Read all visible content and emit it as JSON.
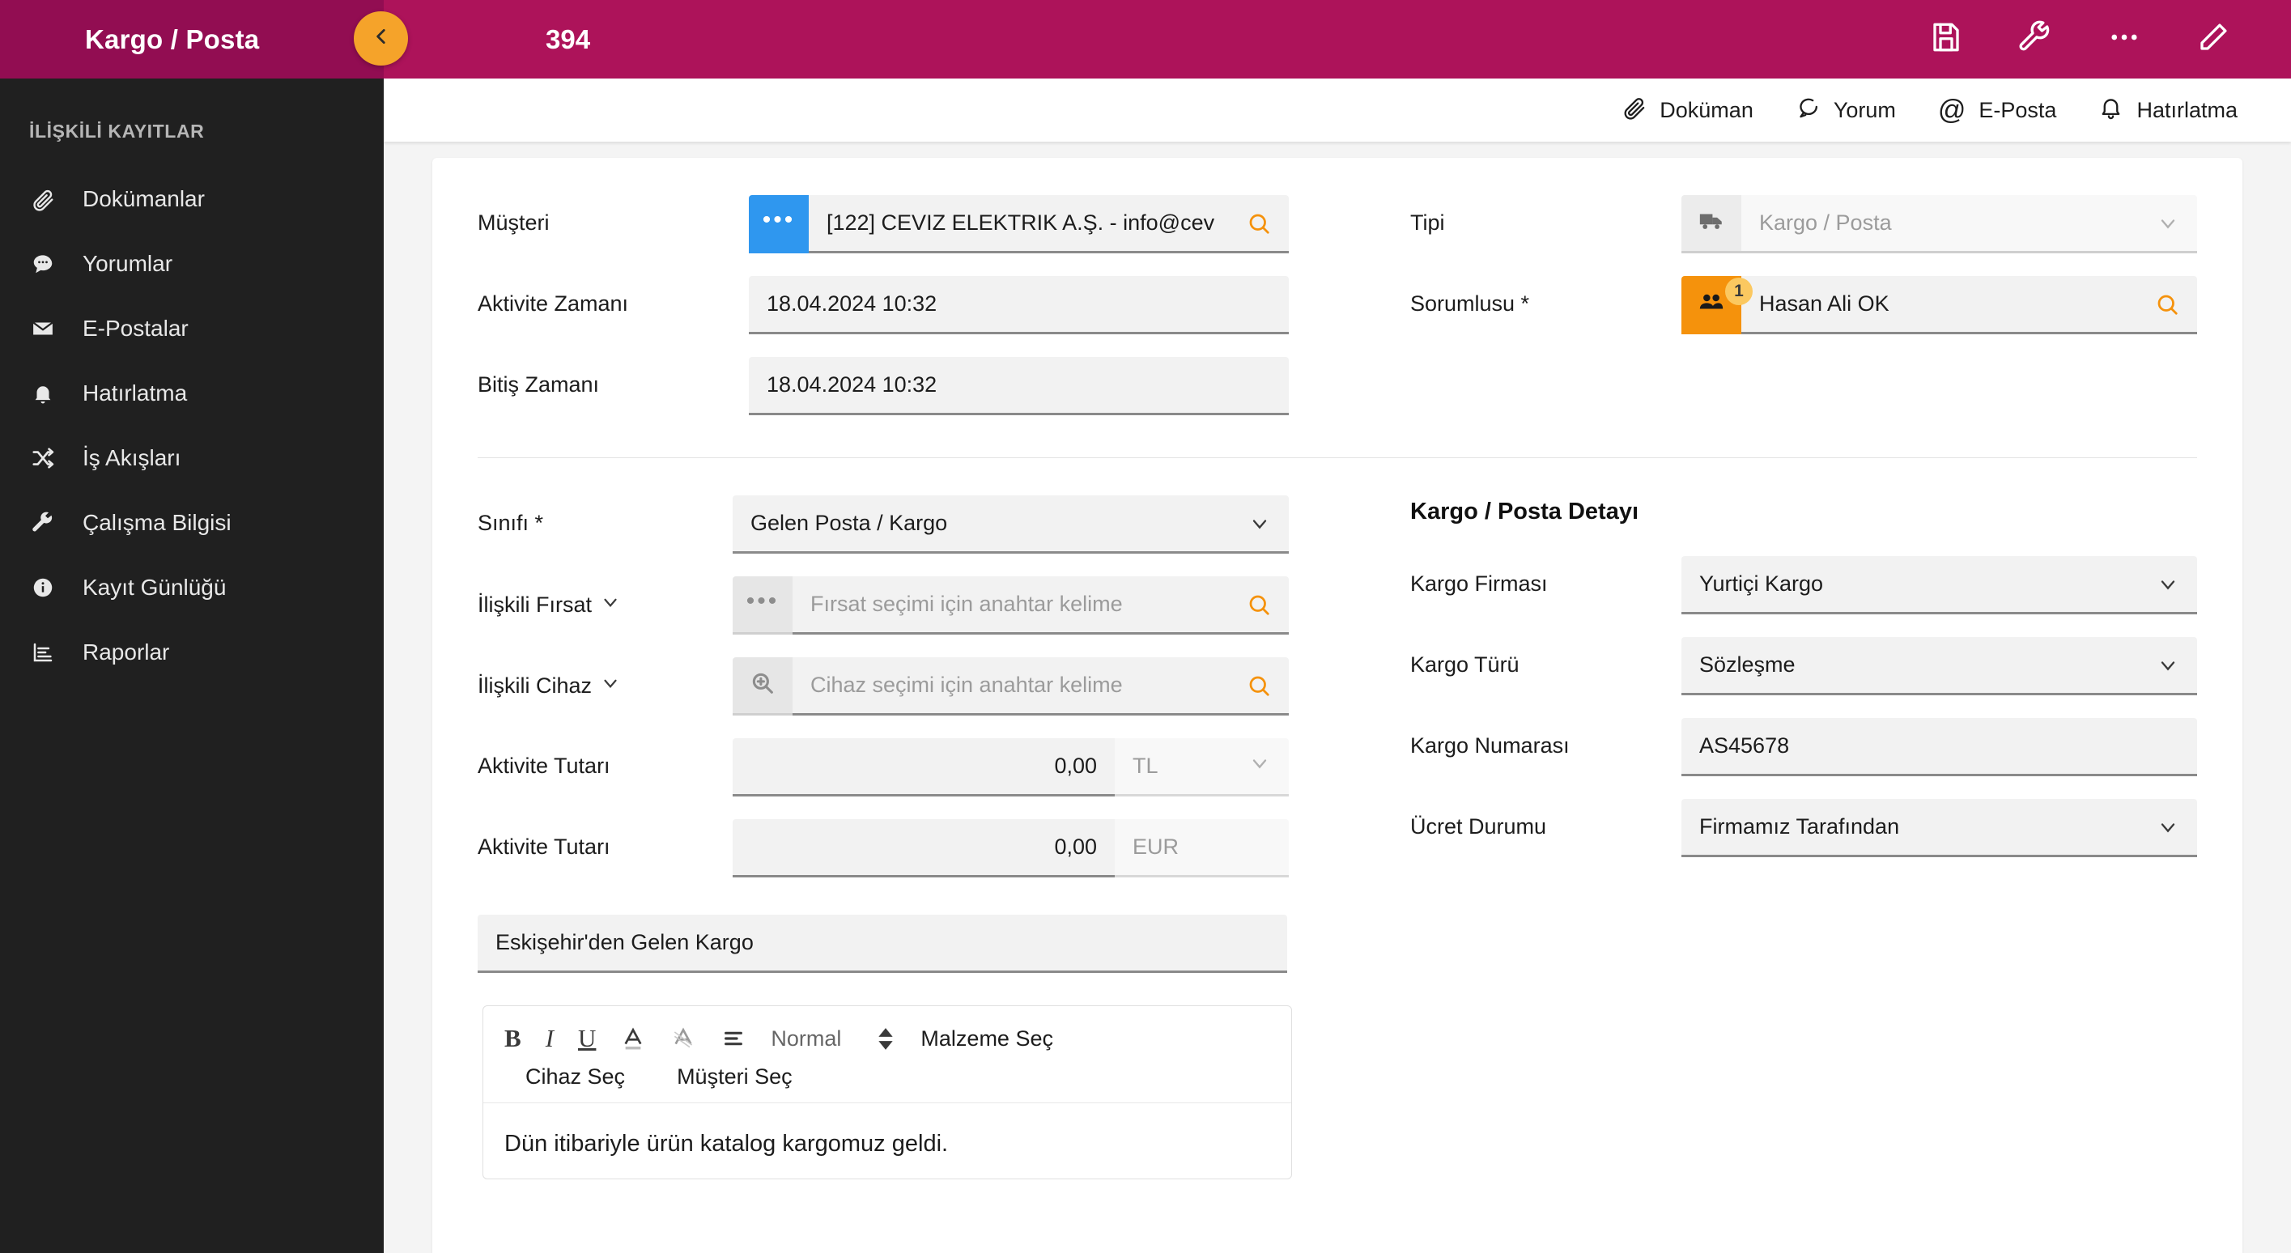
{
  "topbar": {
    "module_title": "Kargo / Posta",
    "record_no": "394",
    "collapse_icon": "chevron-left-icon",
    "actions": [
      {
        "name": "save-button",
        "icon": "floppy-disk-icon"
      },
      {
        "name": "tools-button",
        "icon": "wrench-icon"
      },
      {
        "name": "more-button",
        "icon": "ellipsis-icon"
      },
      {
        "name": "edit-button",
        "icon": "pencil-icon"
      }
    ]
  },
  "tabstrip": {
    "tabs": [
      {
        "label": "Doküman",
        "icon": "paperclip-icon"
      },
      {
        "label": "Yorum",
        "icon": "comment-icon"
      },
      {
        "label": "E-Posta",
        "icon": "at-icon"
      },
      {
        "label": "Hatırlatma",
        "icon": "bell-icon"
      }
    ]
  },
  "sidebar": {
    "heading": "İLİŞKİLİ KAYITLAR",
    "items": [
      {
        "label": "Dokümanlar",
        "icon": "paperclip-icon"
      },
      {
        "label": "Yorumlar",
        "icon": "comment-icon"
      },
      {
        "label": "E-Postalar",
        "icon": "envelope-icon"
      },
      {
        "label": "Hatırlatma",
        "icon": "bell-icon"
      },
      {
        "label": "İş Akışları",
        "icon": "shuffle-icon"
      },
      {
        "label": "Çalışma Bilgisi",
        "icon": "wrench-icon"
      },
      {
        "label": "Kayıt Günlüğü",
        "icon": "info-circle-icon"
      },
      {
        "label": "Raporlar",
        "icon": "report-chart-icon"
      }
    ]
  },
  "form": {
    "musteri": {
      "label": "Müşteri",
      "value": "[122] CEVIZ ELEKTRIK A.Ş.  - info@cev",
      "lookup_icon": "ellipsis-icon",
      "search_icon": "search-icon"
    },
    "aktivite_zamani": {
      "label": "Aktivite Zamanı",
      "value": "18.04.2024 10:32"
    },
    "bitis_zamani": {
      "label": "Bitiş Zamanı",
      "value": "18.04.2024 10:32"
    },
    "tipi": {
      "label": "Tipi",
      "placeholder": "Kargo / Posta",
      "icon": "truck-icon",
      "chevron": "chevron-down-icon"
    },
    "sorumlusu": {
      "label": "Sorumlusu *",
      "value": "Hasan Ali OK",
      "icon": "users-icon",
      "badge": "1",
      "search_icon": "search-icon"
    },
    "sinifi": {
      "label": "Sınıfı *",
      "value": "Gelen Posta / Kargo",
      "chevron": "chevron-down-icon"
    },
    "iliskili_firsat": {
      "label": "İlişkili Fırsat",
      "placeholder": "Fırsat seçimi için anahtar kelime",
      "label_chevron": "chevron-down-icon",
      "lookup_icon": "ellipsis-icon",
      "search_icon": "search-icon"
    },
    "iliskili_cihaz": {
      "label": "İlişkili Cihaz",
      "placeholder": "Cihaz seçimi için anahtar kelime",
      "label_chevron": "chevron-down-icon",
      "lookup_icon": "search-plus-icon",
      "search_icon": "search-icon"
    },
    "aktivite_tutari_tl": {
      "label": "Aktivite Tutarı",
      "value": "0,00",
      "currency": "TL",
      "chevron": "chevron-down-icon"
    },
    "aktivite_tutari_eur": {
      "label": "Aktivite Tutarı",
      "value": "0,00",
      "currency": "EUR"
    },
    "subject": {
      "value": "Eskişehir'den Gelen Kargo"
    }
  },
  "detail": {
    "section_title": "Kargo / Posta Detayı",
    "kargo_firmasi": {
      "label": "Kargo Firması",
      "value": "Yurtiçi Kargo",
      "chevron": "chevron-down-icon"
    },
    "kargo_turu": {
      "label": "Kargo Türü",
      "value": "Sözleşme",
      "chevron": "chevron-down-icon"
    },
    "kargo_numarasi": {
      "label": "Kargo Numarası",
      "value": "AS45678"
    },
    "ucret_durumu": {
      "label": "Ücret Durumu",
      "value": "Firmamız Tarafından",
      "chevron": "chevron-down-icon"
    }
  },
  "editor": {
    "bold": "B",
    "italic": "I",
    "underline": "U",
    "font_color_icon": "text-color-icon",
    "highlight_icon": "text-highlight-icon",
    "align_icon": "align-left-icon",
    "format_select": "Normal",
    "stepper_icon": "stepper-updown-icon",
    "malzeme_sec": "Malzeme Seç",
    "cihaz_sec": "Cihaz Seç",
    "musteri_sec": "Müşteri Seç",
    "body_text": "Dün itibariyle ürün katalog kargomuz geldi."
  },
  "colors": {
    "brand_magenta": "#ad135a",
    "brand_magenta_dark": "#920d52",
    "accent_orange": "#f5a32a",
    "accent_blue": "#2f97ef",
    "sidebar_bg": "#202020"
  }
}
